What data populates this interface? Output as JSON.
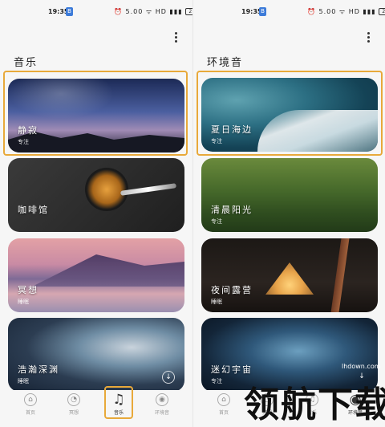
{
  "left": {
    "status": {
      "time": "19:35",
      "bt": "B",
      "icons": "⏰ 5.00 ᯤ HD ▮▮▮",
      "battery": "29"
    },
    "section_title": "音乐",
    "cards": [
      {
        "name": "静寂",
        "tag": "专注"
      },
      {
        "name": "咖啡馆",
        "tag": ""
      },
      {
        "name": "冥想",
        "tag": "睡眠"
      },
      {
        "name": "浩瀚深渊",
        "tag": "睡眠"
      }
    ],
    "nav": [
      {
        "icon": "⌂",
        "label": "首页"
      },
      {
        "icon": "◔",
        "label": "冥想"
      },
      {
        "icon": "♫",
        "label": "音乐"
      },
      {
        "icon": "◉",
        "label": "环境音"
      }
    ]
  },
  "right": {
    "status": {
      "time": "19:35",
      "bt": "B",
      "icons": "⏰ 5.00 ᯤ HD ▮▮▮",
      "battery": "29"
    },
    "section_title": "环境音",
    "cards": [
      {
        "name": "夏日海边",
        "tag": "专注"
      },
      {
        "name": "清晨阳光",
        "tag": "专注"
      },
      {
        "name": "夜间露营",
        "tag": "睡眠"
      },
      {
        "name": "迷幻宇宙",
        "tag": "专注"
      }
    ],
    "nav": [
      {
        "icon": "⌂",
        "label": "首页"
      },
      {
        "icon": "◔",
        "label": "冥想"
      },
      {
        "icon": "♫",
        "label": "音乐"
      },
      {
        "icon": "◉",
        "label": "环境音"
      }
    ]
  },
  "download_icon": "↓",
  "watermark": {
    "text": "领航下载",
    "url": "lhdown.com"
  },
  "colors": {
    "highlight": "#e8a93a"
  }
}
